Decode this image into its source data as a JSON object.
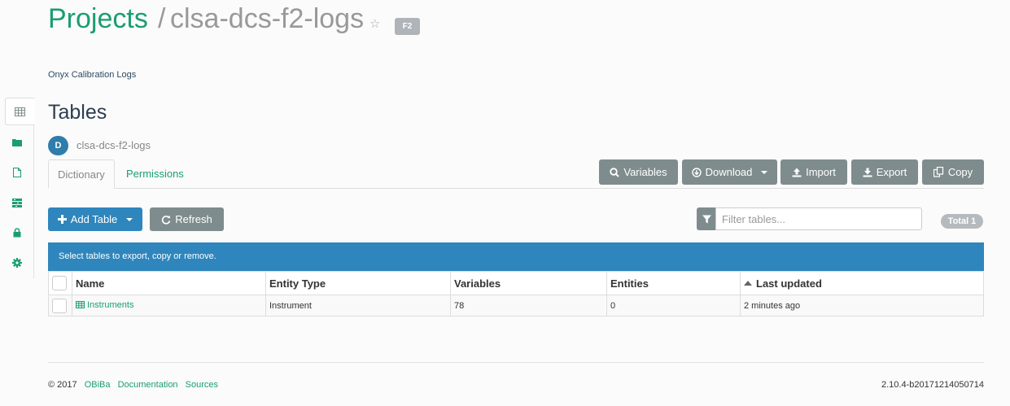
{
  "header": {
    "projects_label": "Projects",
    "separator": "/",
    "project_name": "clsa-dcs-f2-logs",
    "tag": "F2",
    "description": "Onyx Calibration Logs"
  },
  "sidebar": {
    "items": [
      {
        "name": "tables",
        "icon": "table-icon"
      },
      {
        "name": "files",
        "icon": "folder-icon"
      },
      {
        "name": "reports",
        "icon": "file-icon"
      },
      {
        "name": "tasks",
        "icon": "tasks-icon"
      },
      {
        "name": "permissions",
        "icon": "lock-icon"
      },
      {
        "name": "administration",
        "icon": "gear-icon"
      }
    ]
  },
  "main": {
    "title": "Tables",
    "datasource_badge": "D",
    "datasource_name": "clsa-dcs-f2-logs",
    "tabs": [
      {
        "label": "Dictionary",
        "active": true
      },
      {
        "label": "Permissions",
        "active": false
      }
    ],
    "actions": {
      "variables": "Variables",
      "download": "Download",
      "import": "Import",
      "export": "Export",
      "copy": "Copy"
    },
    "toolbar": {
      "add_table": "Add Table",
      "refresh": "Refresh",
      "filter_placeholder": "Filter tables...",
      "total": "Total 1"
    },
    "info_message": "Select tables to export, copy or remove.",
    "table": {
      "columns": [
        "Name",
        "Entity Type",
        "Variables",
        "Entities",
        "Last updated"
      ],
      "rows": [
        {
          "name": "Instruments",
          "entity_type": "Instrument",
          "variables": "78",
          "entities": "0",
          "last_updated": "2 minutes ago"
        }
      ]
    }
  },
  "footer": {
    "copyright": "© 2017",
    "links": [
      "OBiBa",
      "Documentation",
      "Sources"
    ],
    "version": "2.10.4-b20171214050714"
  },
  "colors": {
    "accent_green": "#1a9e6f",
    "primary_blue": "#2e86bd",
    "button_gray": "#7f8c8d"
  }
}
